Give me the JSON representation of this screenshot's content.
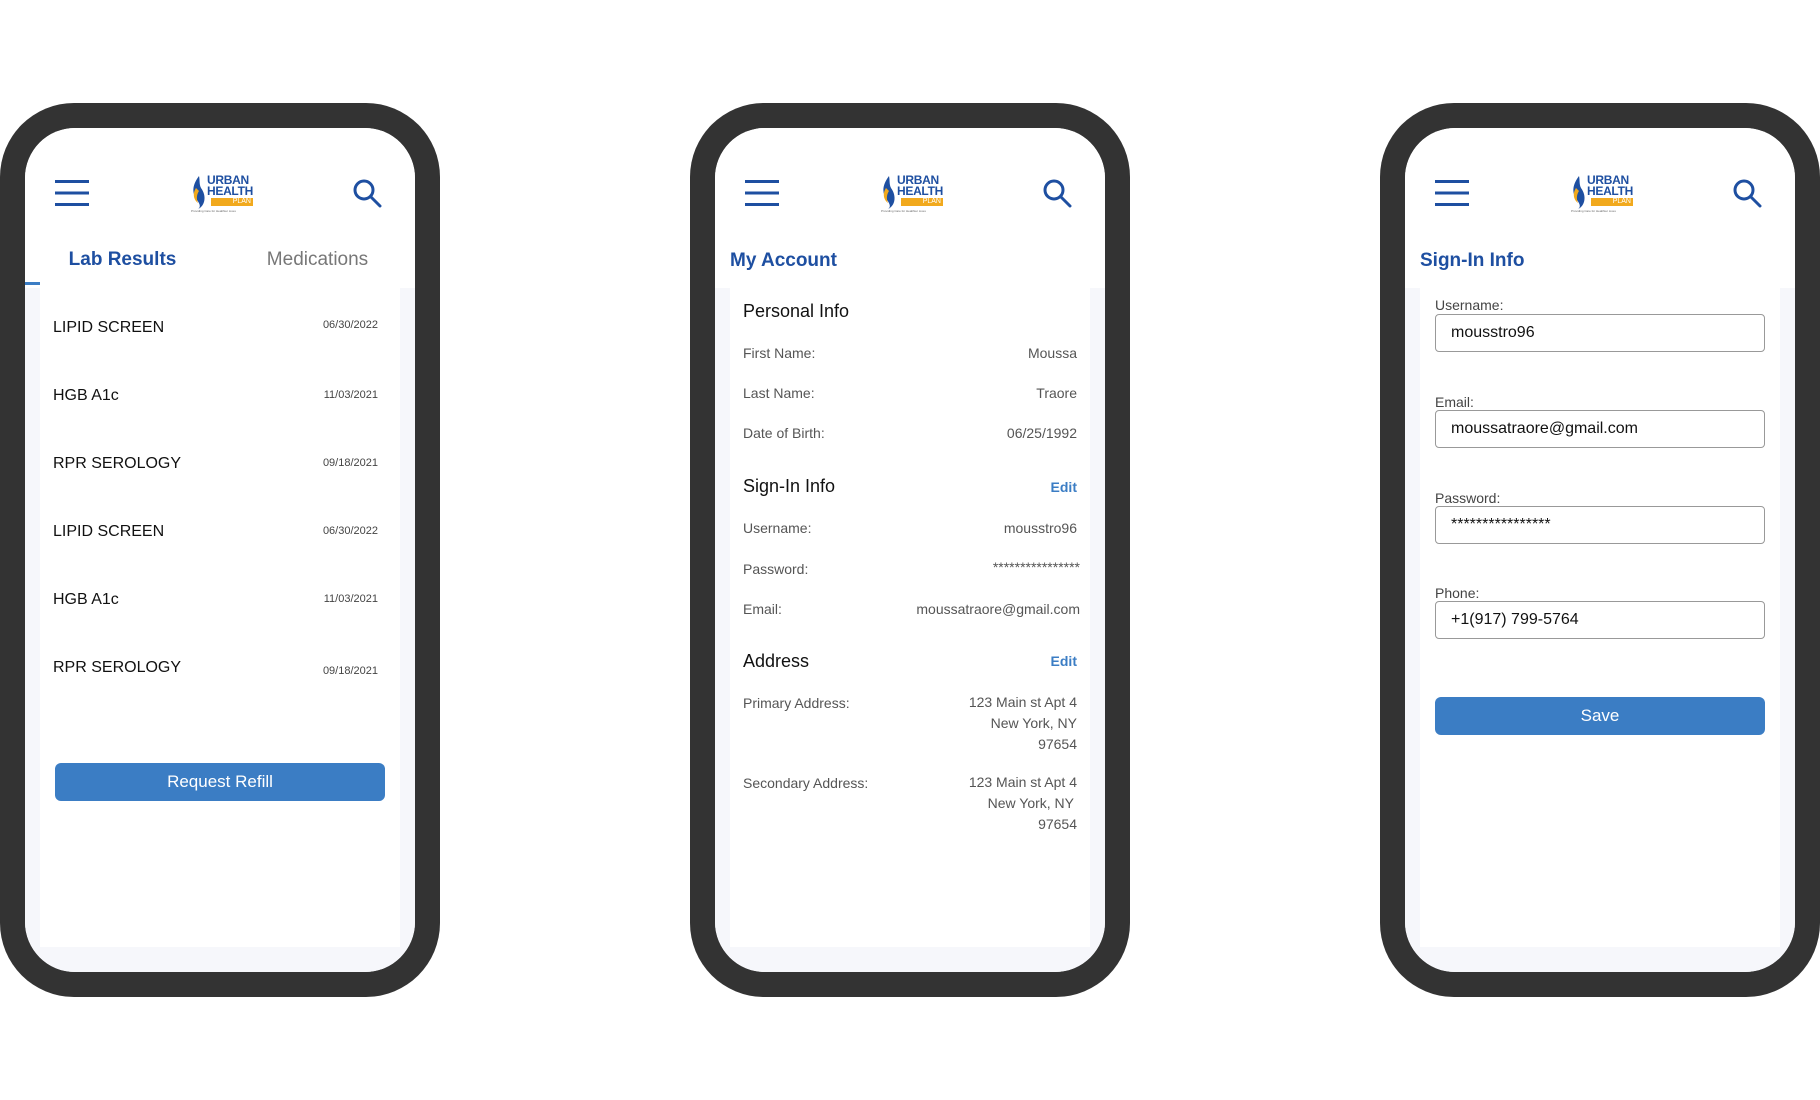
{
  "brand": {
    "logo_line1": "URBAN",
    "logo_line2": "HEALTH",
    "logo_line3": "PLAN",
    "tagline": "Providing Care for Healthier Lives",
    "accent": "#1e4fa1",
    "button": "#3b7dc4",
    "logo_orange": "#f1a91d"
  },
  "screen1": {
    "tabs": [
      {
        "label": "Lab Results",
        "active": true
      },
      {
        "label": "Medications",
        "active": false
      }
    ],
    "lab_results": [
      {
        "name": "LIPID SCREEN",
        "date": "06/30/2022"
      },
      {
        "name": "HGB A1c",
        "date": "11/03/2021"
      },
      {
        "name": "RPR SEROLOGY",
        "date": "09/18/2021"
      },
      {
        "name": "LIPID SCREEN",
        "date": "06/30/2022"
      },
      {
        "name": "HGB A1c",
        "date": "11/03/2021"
      },
      {
        "name": "RPR SEROLOGY",
        "date": "09/18/2021"
      }
    ],
    "request_refill_label": "Request Refill"
  },
  "screen2": {
    "title": "My Account",
    "personal_info": {
      "heading": "Personal Info",
      "first_name_label": "First Name:",
      "first_name": "Moussa",
      "last_name_label": "Last Name:",
      "last_name": "Traore",
      "dob_label": "Date of Birth:",
      "dob": "06/25/1992"
    },
    "signin_info": {
      "heading": "Sign-In Info",
      "edit_label": "Edit",
      "username_label": "Username:",
      "username": "mousstro96",
      "password_label": "Password:",
      "password": "****************",
      "email_label": "Email:",
      "email": "moussatraore@gmail.com"
    },
    "address": {
      "heading": "Address",
      "edit_label": "Edit",
      "primary_label": "Primary Address:",
      "primary_line1": "123 Main st Apt 4",
      "primary_line2": "New York, NY",
      "primary_line3": "97654",
      "secondary_label": "Secondary Address:",
      "secondary_line1": "123 Main st Apt 4",
      "secondary_line2": "New York, NY",
      "secondary_line3": "97654"
    }
  },
  "screen3": {
    "title": "Sign-In Info",
    "username_label": "Username:",
    "username": "mousstro96",
    "email_label": "Email:",
    "email": "moussatraore@gmail.com",
    "password_label": "Password:",
    "password": "****************",
    "phone_label": "Phone:",
    "phone": "+1(917) 799-5764",
    "save_label": "Save"
  }
}
